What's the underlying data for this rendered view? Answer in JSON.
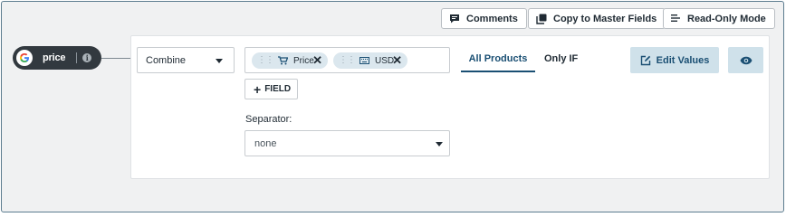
{
  "toolbar": {
    "comments_label": "Comments",
    "copy_label": "Copy to Master Fields",
    "readonly_label": "Read-Only Mode"
  },
  "field": {
    "name": "price",
    "info_glyph": "i",
    "icon": "google-logo-icon"
  },
  "mapping": {
    "mode": "Combine",
    "tags": [
      {
        "label": "Price",
        "icon": "cart-icon"
      },
      {
        "label": "USD",
        "icon": "keyboard-icon"
      }
    ],
    "add_field_label": "FIELD",
    "separator_label": "Separator:",
    "separator_value": "none"
  },
  "tabs": {
    "all_products": "All Products",
    "only_if": "Only IF",
    "active": "All Products"
  },
  "actions": {
    "edit_values_label": "Edit Values",
    "preview_icon": "eye-icon"
  },
  "colors": {
    "accent": "#1a4f73",
    "accent_light": "#cfe1ea",
    "tag_bg": "#dbe7ee",
    "pill_bg": "#32393f",
    "frame_border": "#5c7c8f"
  }
}
